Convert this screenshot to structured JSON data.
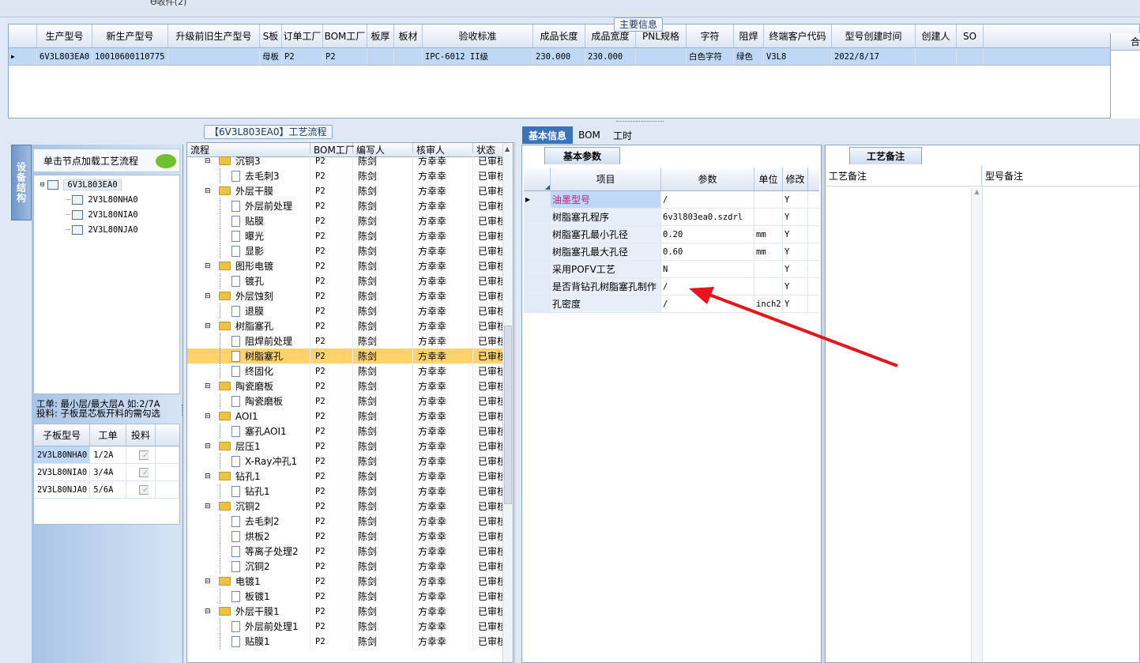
{
  "top_strip": {
    "text": "Ѳ收件(2)"
  },
  "main_info": {
    "legend": "主要信息",
    "columns": [
      "生产型号",
      "新生产型号",
      "升级前旧生产型号",
      "S板",
      "订单工厂",
      "BOM工厂",
      "板厚",
      "板材",
      "验收标准",
      "成品长度",
      "成品宽度",
      "PNL规格",
      "字符",
      "阻焊",
      "终端客户代码",
      "型号创建时间",
      "创建人",
      "SO"
    ],
    "row": [
      "6V3L803EA0",
      "10010600110775",
      "",
      "母板",
      "P2",
      "P2",
      "",
      "",
      "IPC-6012 II级",
      "230.000",
      "230.000",
      "",
      "白色字符",
      "绿色",
      "V3L8",
      "2022/8/17",
      "",
      ""
    ],
    "right_header": "合"
  },
  "process": {
    "legend": "【6V3L803EA0】工艺流程",
    "columns": [
      "流程",
      "BOM工厂",
      "编写人",
      "核审人",
      "状态"
    ],
    "rows": [
      {
        "name": "沉铜3",
        "type": "folder",
        "level": 1,
        "bom": "P2",
        "writer": "陈剑",
        "reviewer": "方幸幸",
        "status": "已审核"
      },
      {
        "name": "去毛刺3",
        "type": "page",
        "level": 2,
        "bom": "P2",
        "writer": "陈剑",
        "reviewer": "方幸幸",
        "status": "已审核"
      },
      {
        "name": "外层干膜",
        "type": "folder",
        "level": 1,
        "bom": "P2",
        "writer": "陈剑",
        "reviewer": "方幸幸",
        "status": "已审核"
      },
      {
        "name": "外层前处理",
        "type": "page",
        "level": 2,
        "bom": "P2",
        "writer": "陈剑",
        "reviewer": "方幸幸",
        "status": "已审核"
      },
      {
        "name": "贴膜",
        "type": "page",
        "level": 2,
        "bom": "P2",
        "writer": "陈剑",
        "reviewer": "方幸幸",
        "status": "已审核"
      },
      {
        "name": "曝光",
        "type": "page",
        "level": 2,
        "bom": "P2",
        "writer": "陈剑",
        "reviewer": "方幸幸",
        "status": "已审核"
      },
      {
        "name": "显影",
        "type": "page",
        "level": 2,
        "bom": "P2",
        "writer": "陈剑",
        "reviewer": "方幸幸",
        "status": "已审核"
      },
      {
        "name": "图形电镀",
        "type": "folder",
        "level": 1,
        "bom": "P2",
        "writer": "陈剑",
        "reviewer": "方幸幸",
        "status": "已审核"
      },
      {
        "name": "镀孔",
        "type": "page",
        "level": 2,
        "bom": "P2",
        "writer": "陈剑",
        "reviewer": "方幸幸",
        "status": "已审核"
      },
      {
        "name": "外层蚀刻",
        "type": "folder",
        "level": 1,
        "bom": "P2",
        "writer": "陈剑",
        "reviewer": "方幸幸",
        "status": "已审核"
      },
      {
        "name": "退膜",
        "type": "page",
        "level": 2,
        "bom": "P2",
        "writer": "陈剑",
        "reviewer": "方幸幸",
        "status": "已审核"
      },
      {
        "name": "树脂塞孔",
        "type": "folder",
        "level": 1,
        "bom": "P2",
        "writer": "陈剑",
        "reviewer": "方幸幸",
        "status": "已审核"
      },
      {
        "name": "阻焊前处理",
        "type": "page",
        "level": 2,
        "bom": "P2",
        "writer": "陈剑",
        "reviewer": "方幸幸",
        "status": "已审核"
      },
      {
        "name": "树脂塞孔",
        "type": "page",
        "level": 2,
        "bom": "P2",
        "writer": "陈剑",
        "reviewer": "方幸幸",
        "status": "已审核",
        "selected": true
      },
      {
        "name": "终固化",
        "type": "page",
        "level": 2,
        "bom": "P2",
        "writer": "陈剑",
        "reviewer": "方幸幸",
        "status": "已审核"
      },
      {
        "name": "陶瓷磨板",
        "type": "folder",
        "level": 1,
        "bom": "P2",
        "writer": "陈剑",
        "reviewer": "方幸幸",
        "status": "已审核"
      },
      {
        "name": "陶瓷磨板",
        "type": "page",
        "level": 2,
        "bom": "P2",
        "writer": "陈剑",
        "reviewer": "方幸幸",
        "status": "已审核"
      },
      {
        "name": "AOI1",
        "type": "folder",
        "level": 1,
        "bom": "P2",
        "writer": "陈剑",
        "reviewer": "方幸幸",
        "status": "已审核"
      },
      {
        "name": "塞孔AOI1",
        "type": "page",
        "level": 2,
        "bom": "P2",
        "writer": "陈剑",
        "reviewer": "方幸幸",
        "status": "已审核"
      },
      {
        "name": "层压1",
        "type": "folder",
        "level": 1,
        "bom": "P2",
        "writer": "陈剑",
        "reviewer": "方幸幸",
        "status": "已审核"
      },
      {
        "name": "X-Ray冲孔1",
        "type": "page",
        "level": 2,
        "bom": "P2",
        "writer": "陈剑",
        "reviewer": "方幸幸",
        "status": "已审核"
      },
      {
        "name": "钻孔1",
        "type": "folder",
        "level": 1,
        "bom": "P2",
        "writer": "陈剑",
        "reviewer": "方幸幸",
        "status": "已审核"
      },
      {
        "name": "钻孔1",
        "type": "page",
        "level": 2,
        "bom": "P2",
        "writer": "陈剑",
        "reviewer": "方幸幸",
        "status": "已审核"
      },
      {
        "name": "沉铜2",
        "type": "folder",
        "level": 1,
        "bom": "P2",
        "writer": "陈剑",
        "reviewer": "方幸幸",
        "status": "已审核"
      },
      {
        "name": "去毛刺2",
        "type": "page",
        "level": 2,
        "bom": "P2",
        "writer": "陈剑",
        "reviewer": "方幸幸",
        "status": "已审核"
      },
      {
        "name": "烘板2",
        "type": "page",
        "level": 2,
        "bom": "P2",
        "writer": "陈剑",
        "reviewer": "方幸幸",
        "status": "已审核"
      },
      {
        "name": "等离子处理2",
        "type": "page",
        "level": 2,
        "bom": "P2",
        "writer": "陈剑",
        "reviewer": "方幸幸",
        "status": "已审核"
      },
      {
        "name": "沉铜2",
        "type": "page",
        "level": 2,
        "bom": "P2",
        "writer": "陈剑",
        "reviewer": "方幸幸",
        "status": "已审核"
      },
      {
        "name": "电镀1",
        "type": "folder",
        "level": 1,
        "bom": "P2",
        "writer": "陈剑",
        "reviewer": "方幸幸",
        "status": "已审核"
      },
      {
        "name": "板镀1",
        "type": "page",
        "level": 2,
        "bom": "P2",
        "writer": "陈剑",
        "reviewer": "方幸幸",
        "status": "已审核"
      },
      {
        "name": "外层干膜1",
        "type": "folder",
        "level": 1,
        "bom": "P2",
        "writer": "陈剑",
        "reviewer": "方幸幸",
        "status": "已审核"
      },
      {
        "name": "外层前处理1",
        "type": "page",
        "level": 2,
        "bom": "P2",
        "writer": "陈剑",
        "reviewer": "方幸幸",
        "status": "已审核"
      },
      {
        "name": "贴膜1",
        "type": "page",
        "level": 2,
        "bom": "P2",
        "writer": "陈剑",
        "reviewer": "方幸幸",
        "status": "已审核"
      }
    ]
  },
  "structure": {
    "side_tab": "设备结构",
    "hint": "单击节点加载工艺流程",
    "tree": [
      "6V3L803EA0",
      "2V3L80NHA0",
      "2V3L80NIA0",
      "2V3L80NJA0"
    ],
    "note_line1": "工单: 最小层/最大层A 如:2/7A",
    "note_line2": "投料: 子板是芯板开料的需勾选",
    "sub_columns": [
      "子板型号",
      "工单",
      "投料"
    ],
    "sub_rows": [
      {
        "model": "2V3L80NHA0",
        "order": "1/2A",
        "feed": true
      },
      {
        "model": "2V3L80NIA0",
        "order": "3/4A",
        "feed": true
      },
      {
        "model": "2V3L80NJA0",
        "order": "5/6A",
        "feed": true
      }
    ]
  },
  "right": {
    "tabs": [
      "基本信息",
      "BOM",
      "工时"
    ],
    "params_title": "基本参数",
    "params_columns": [
      "项目",
      "参数",
      "单位",
      "修改"
    ],
    "params": [
      {
        "item": "油墨型号",
        "value": "/",
        "unit": "",
        "edit": "Y",
        "highlight": true
      },
      {
        "item": "树脂塞孔程序",
        "value": "6v3l803ea0.szdrl",
        "unit": "",
        "edit": "Y"
      },
      {
        "item": "树脂塞孔最小孔径",
        "value": "0.20",
        "unit": "mm",
        "edit": "Y"
      },
      {
        "item": "树脂塞孔最大孔径",
        "value": "0.60",
        "unit": "mm",
        "edit": "Y"
      },
      {
        "item": "采用POFV工艺",
        "value": "N",
        "unit": "",
        "edit": "Y"
      },
      {
        "item": "是否背钻孔树脂塞孔制作",
        "value": "/",
        "unit": "",
        "edit": "Y"
      },
      {
        "item": "孔密度",
        "value": "/",
        "unit": "inch2",
        "edit": "Y"
      }
    ],
    "notes_title": "工艺备注",
    "notes_columns": [
      "工艺备注",
      "型号备注"
    ]
  },
  "colors": {
    "accent": "#3b73b9",
    "selection": "#ffd36b",
    "row_selected": "#bfd8f6",
    "arrow": "#e8141b"
  }
}
